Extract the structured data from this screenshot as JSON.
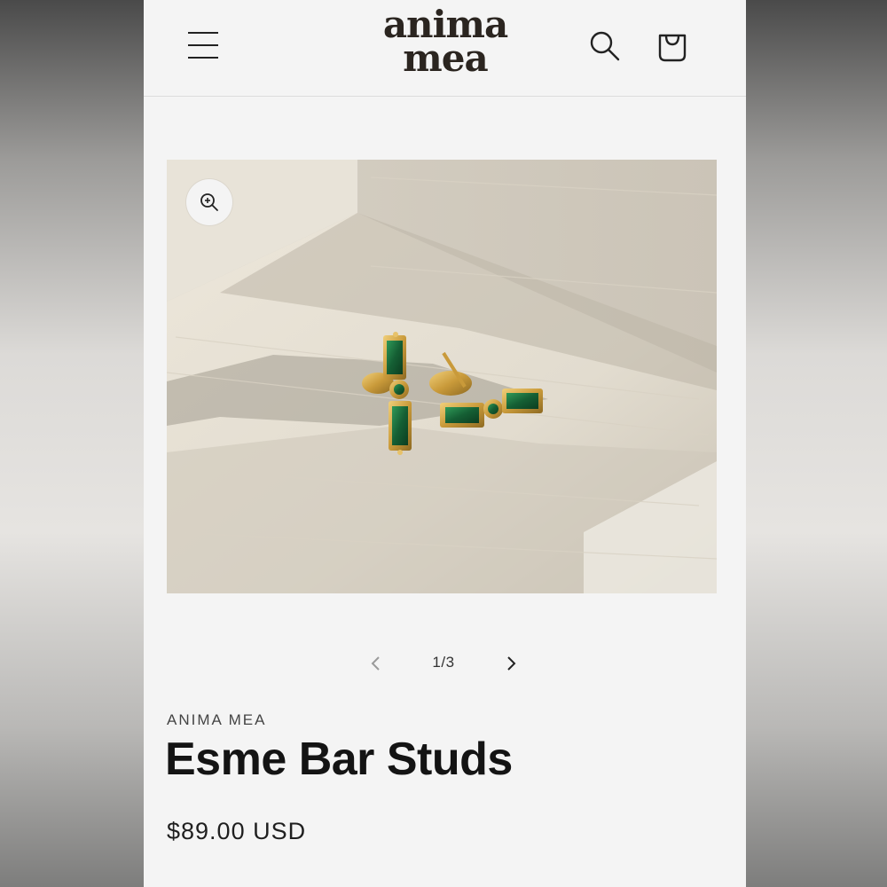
{
  "header": {
    "logo_line1": "anima",
    "logo_line2": "mea",
    "menu_icon": "hamburger-menu-icon",
    "search_icon": "search-icon",
    "cart_icon": "cart-bag-icon"
  },
  "gallery": {
    "zoom_icon": "zoom-in-icon",
    "counter": "1/3",
    "prev_icon": "chevron-left-icon",
    "next_icon": "chevron-right-icon"
  },
  "product": {
    "vendor": "ANIMA MEA",
    "title": "Esme Bar Studs",
    "price": "$89.00 USD"
  },
  "colors": {
    "page_background": "#f4f4f4",
    "text_dark": "#141414",
    "logo": "#2b2520",
    "gem_green": "#1f6b3a",
    "gold": "#c99a3a"
  }
}
